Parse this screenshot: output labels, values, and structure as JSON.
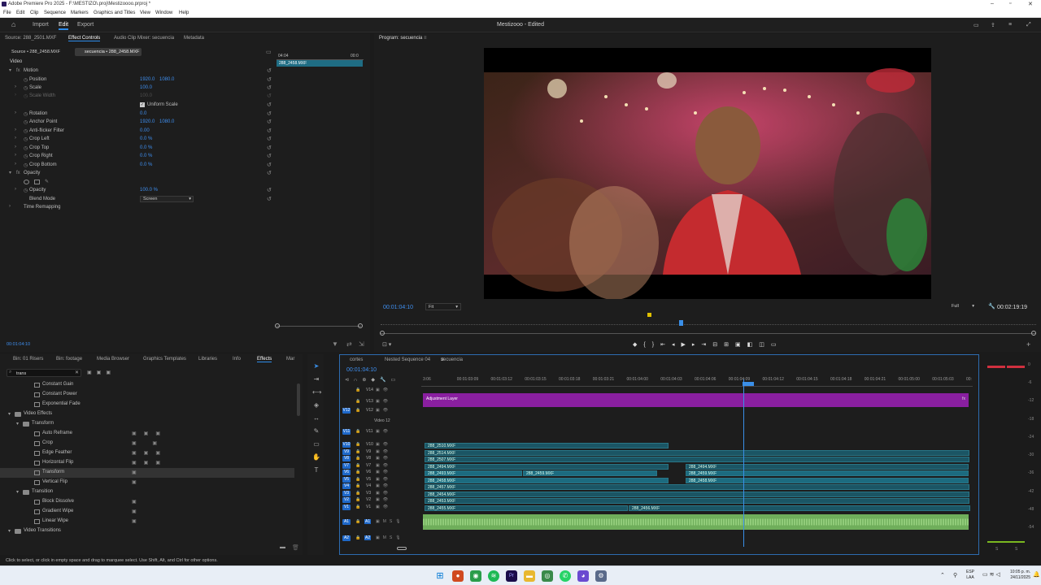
{
  "window": {
    "title": "Adobe Premiere Pro 2025 - F:\\MESTIZO\\.proj\\Mestizoooo.prproj *"
  },
  "menu": [
    "File",
    "Edit",
    "Clip",
    "Sequence",
    "Markers",
    "Graphics and Titles",
    "View",
    "Window",
    "Help"
  ],
  "workspace": {
    "tabs": [
      "Import",
      "Edit",
      "Export"
    ],
    "active": "Edit",
    "project_name": "Mestizooo - Edited"
  },
  "source_panel": {
    "tabs": [
      "Source: 288_2501.MXF",
      "Effect Controls",
      "Audio Clip Mixer: secuencia",
      "Metadata"
    ],
    "source_label": "Source • 288_2458.MXF",
    "sequence_label": "secuencia • 288_2458.MXF",
    "mini_timeline": {
      "start": "04:04",
      "end": "00:0",
      "clip": "288_2458.MXF"
    },
    "video_header": "Video",
    "motion_label": "Motion",
    "properties": [
      {
        "label": "Position",
        "value": "1920.0",
        "value2": "1080.0"
      },
      {
        "label": "Scale",
        "value": "100.0",
        "value2": ""
      },
      {
        "label": "Scale Width",
        "value": "100.0",
        "value2": ""
      },
      {
        "label": "Uniform Scale",
        "value": "",
        "value2": ""
      },
      {
        "label": "Rotation",
        "value": "0.0",
        "value2": ""
      },
      {
        "label": "Anchor Point",
        "value": "1920.0",
        "value2": "1080.0"
      },
      {
        "label": "Anti-flicker Filter",
        "value": "0.00",
        "value2": ""
      },
      {
        "label": "Crop Left",
        "value": "0.0 %",
        "value2": ""
      },
      {
        "label": "Crop Top",
        "value": "0.0 %",
        "value2": ""
      },
      {
        "label": "Crop Right",
        "value": "0.0 %",
        "value2": ""
      },
      {
        "label": "Crop Bottom",
        "value": "0.0 %",
        "value2": ""
      }
    ],
    "opacity_header": "Opacity",
    "opacity": {
      "label": "Opacity",
      "value": "100.0 %"
    },
    "blend_mode": {
      "label": "Blend Mode",
      "value": "Screen"
    },
    "time_remapping": "Time Remapping",
    "timecode": "00:01:04:10"
  },
  "program_monitor": {
    "title": "Program: secuencia",
    "timecode": "00:01:04:10",
    "fit": "Fit",
    "quality": "Full",
    "duration": "00:02:19:19"
  },
  "effects_panel": {
    "tabs": [
      "Bin: 01 Risers",
      "Bin: footage",
      "Media Browser",
      "Graphics Templates",
      "Libraries",
      "Info",
      "Effects",
      "Mar"
    ],
    "active_tab": "Effects",
    "search_value": "trans",
    "items": [
      {
        "label": "Constant Gain",
        "indent": 2,
        "kind": "fx"
      },
      {
        "label": "Constant Power",
        "indent": 2,
        "kind": "fx"
      },
      {
        "label": "Exponential Fade",
        "indent": 2,
        "kind": "fx"
      },
      {
        "label": "Video Effects",
        "indent": 0,
        "kind": "folder"
      },
      {
        "label": "Transform",
        "indent": 1,
        "kind": "folder"
      },
      {
        "label": "Auto Reframe",
        "indent": 2,
        "kind": "fx"
      },
      {
        "label": "Crop",
        "indent": 2,
        "kind": "fx"
      },
      {
        "label": "Edge Feather",
        "indent": 2,
        "kind": "fx"
      },
      {
        "label": "Horizontal Flip",
        "indent": 2,
        "kind": "fx"
      },
      {
        "label": "Transform",
        "indent": 2,
        "kind": "fx",
        "selected": true
      },
      {
        "label": "Vertical Flip",
        "indent": 2,
        "kind": "fx"
      },
      {
        "label": "Transition",
        "indent": 1,
        "kind": "folder"
      },
      {
        "label": "Block Dissolve",
        "indent": 2,
        "kind": "fx"
      },
      {
        "label": "Gradient Wipe",
        "indent": 2,
        "kind": "fx"
      },
      {
        "label": "Linear Wipe",
        "indent": 2,
        "kind": "fx"
      },
      {
        "label": "Video Transitions",
        "indent": 0,
        "kind": "folder"
      }
    ]
  },
  "timeline": {
    "tabs": [
      "cortes",
      "Nested Sequence 04",
      "secuencia"
    ],
    "active_tab": "secuencia",
    "timecode": "00:01:04:10",
    "ruler": [
      "3:06",
      "00:01:03:09",
      "00:01:03:12",
      "00:01:03:15",
      "00:01:03:18",
      "00:01:03:21",
      "00:01:04:00",
      "00:01:04:03",
      "00:01:04:06",
      "00:01:04:09",
      "00:01:04:12",
      "00:01:04:15",
      "00:01:04:18",
      "00:01:04:21",
      "00:01:05:00",
      "00:01:05:03",
      "00:"
    ],
    "tracks": [
      {
        "name": "V14",
        "badge": ""
      },
      {
        "name": "V13",
        "badge": ""
      },
      {
        "name": "V12",
        "badge": "V12"
      },
      {
        "name": "Video 12",
        "badge": ""
      },
      {
        "name": "V11",
        "badge": "V11"
      },
      {
        "name": "V10",
        "badge": "V10"
      },
      {
        "name": "V9",
        "badge": "V9"
      },
      {
        "name": "V8",
        "badge": "V8"
      },
      {
        "name": "V7",
        "badge": "V7"
      },
      {
        "name": "V6",
        "badge": "V6"
      },
      {
        "name": "V5",
        "badge": "V5"
      },
      {
        "name": "V4",
        "badge": "V4"
      },
      {
        "name": "V3",
        "badge": "V3"
      },
      {
        "name": "V2",
        "badge": "V2"
      },
      {
        "name": "V1",
        "badge": "V1"
      },
      {
        "name": "A1",
        "badge": "A1"
      },
      {
        "name": "A2",
        "badge": "A2"
      }
    ],
    "adjustment_layer": "Adjustment Layer",
    "clips": [
      "288_2510.MXF",
      "288_2514.MXF",
      "288_2507.MXF",
      "288_2494.MXF",
      "288_2493.MXF",
      "288_2459.MXF",
      "288_2458.MXF",
      "288_2457.MXF",
      "288_2454.MXF",
      "288_2453.MXF",
      "288_2455.MXF",
      "288_2456.MXF",
      "288_2494.MXF",
      "288_2459.MXF",
      "288_2458.MXF"
    ]
  },
  "meters": {
    "scale": [
      "0",
      "-6",
      "-12",
      "-18",
      "-24",
      "-30",
      "-36",
      "-42",
      "-48",
      "-54"
    ],
    "footer": [
      "S",
      "S"
    ]
  },
  "status_bar": "Click to select, or click in empty space and drag to marquee select. Use Shift, Alt, and Ctrl for other options.",
  "taskbar": {
    "lang": "ESP",
    "region": "LAA",
    "time": "10:05 p. m.",
    "date": "24/11/2025"
  }
}
